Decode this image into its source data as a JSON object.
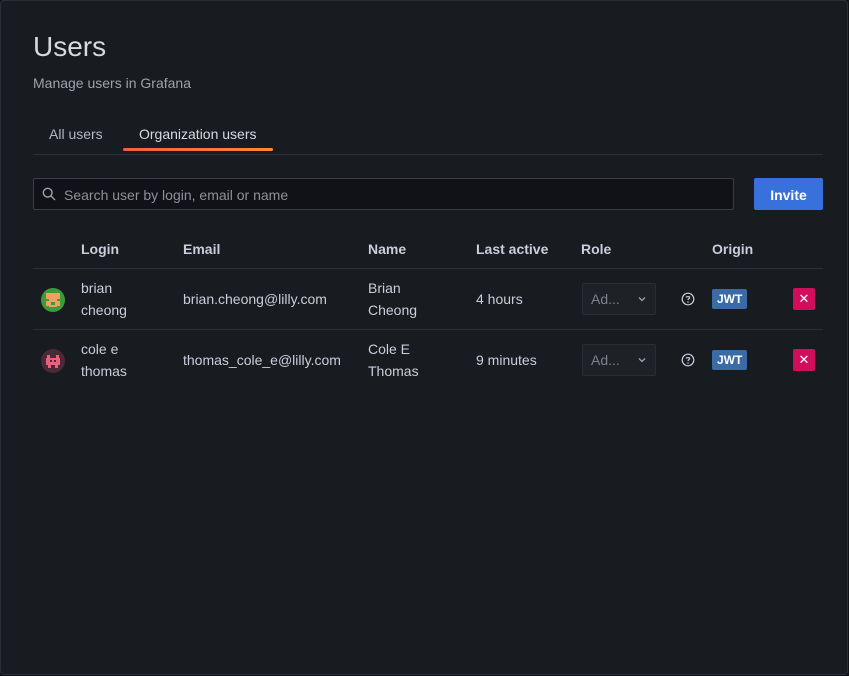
{
  "page": {
    "title": "Users",
    "subtitle": "Manage users in Grafana"
  },
  "tabs": [
    {
      "label": "All users",
      "active": false
    },
    {
      "label": "Organization users",
      "active": true
    }
  ],
  "search": {
    "placeholder": "Search user by login, email or name",
    "value": ""
  },
  "invite_label": "Invite",
  "table": {
    "headers": {
      "login": "Login",
      "email": "Email",
      "name": "Name",
      "last_active": "Last active",
      "role": "Role",
      "origin": "Origin"
    },
    "rows": [
      {
        "login_line1": "brian",
        "login_line2": "cheong",
        "email": "brian.cheong@lilly.com",
        "name_line1": "Brian",
        "name_line2": "Cheong",
        "last_active": "4 hours",
        "role": "Ad...",
        "origin": "JWT",
        "avatar_icon": "avatar-green-icon"
      },
      {
        "login_line1": "cole e",
        "login_line2": "thomas",
        "email": "thomas_cole_e@lilly.com",
        "name_line1": "Cole E",
        "name_line2": "Thomas",
        "last_active": "9 minutes",
        "role": "Ad...",
        "origin": "JWT",
        "avatar_icon": "avatar-pink-icon"
      }
    ]
  },
  "colors": {
    "background": "#181b1f",
    "accent": "#3871dc",
    "tab_underline": "#f55f3e",
    "badge": "#3b6ba5",
    "delete": "#d10e5c"
  }
}
